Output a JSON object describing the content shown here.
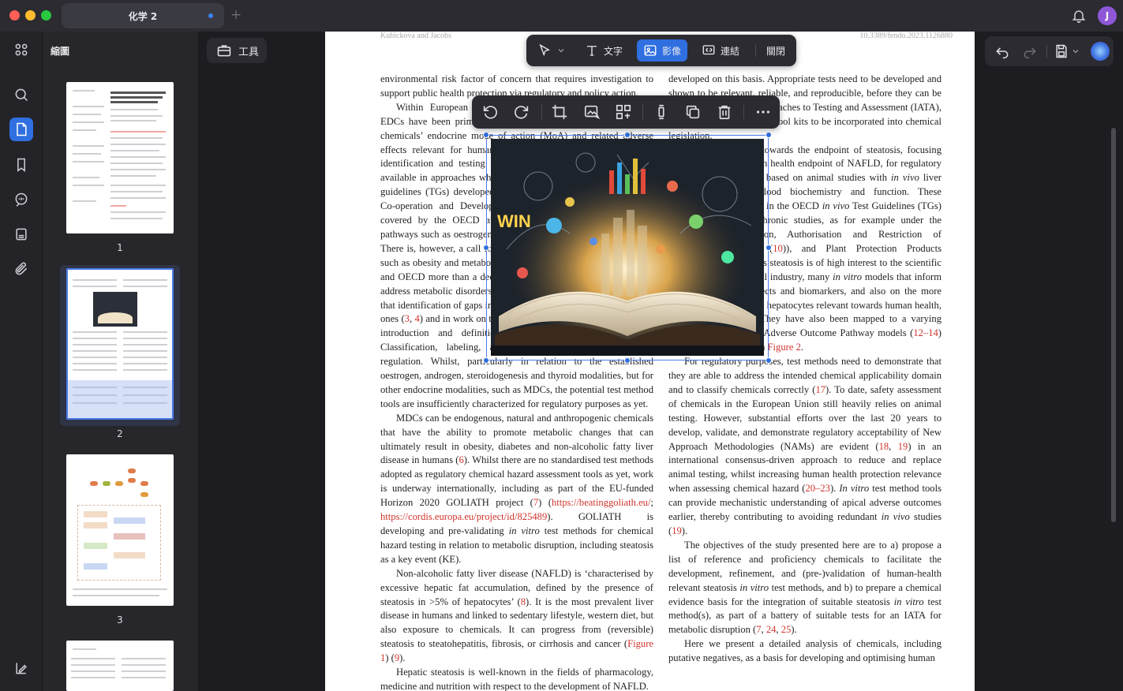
{
  "window": {
    "tab_title": "化学 2",
    "tab_add": "+",
    "avatar_letter": "J"
  },
  "sidebar": {
    "panel_title": "縮圖",
    "tools_label": "工具"
  },
  "thumbnails": [
    {
      "page": "1"
    },
    {
      "page": "2"
    },
    {
      "page": "3"
    }
  ],
  "toolbar": {
    "text_label": "文字",
    "image_label": "影像",
    "link_label": "連結",
    "close_label": "關閉"
  },
  "document": {
    "header_left": "Kubickova and Jacobs",
    "header_right": "10.3389/fendo.2023.1126880",
    "left_col": [
      {
        "indent": false,
        "html": "environmental risk factor of concern that requires investigation to support public health protection via regulatory and policy action."
      },
      {
        "indent": true,
        "html": "Within European Union (EU) and international guidelines, EDCs have been primarily identified and classified based on the chemicals’ endocrine mode of action (MoA) and related adverse effects relevant for human health. At present, methods for the identification and testing of EDCs according to their MoA are available in approaches which mainly incorporate standardised test guidelines (TGs) developed under the Organisation for Economic Co-operation and Development (OECD). Current test methods covered by the OECD are based upon well-studied endocrine pathways such as oestrogen, androgen, steroidogenesis and thyroid. There is, however, a call for additional endocrine-related endpoints such as obesity and metabolic disruption, was recognized in the EU and OECD more than a decade ago (<span class=\"ref\">2</span>). The need for methods that address metabolic disorders has been pointed out in various reports that identification of gaps in available methods and the need for new ones (<span class=\"ref\">3</span>, <span class=\"ref\">4</span>) and in work on test guideline programmes, as well as the introduction and definition of new hazard classes in the Classification, labeling, and packaging of chemicals (CLP) regulation. Whilst, particularly in relation to the established oestrogen, androgen, steroidogenesis and thyroid modalities, but for other endocrine modalities, such as MDCs, the potential test method tools are insufficiently characterized for regulatory purposes as yet."
      },
      {
        "indent": true,
        "html": "MDCs can be endogenous, natural and anthropogenic chemicals that have the ability to promote metabolic changes that can ultimately result in obesity, diabetes and non-alcoholic fatty liver disease in humans (<span class=\"ref\">6</span>). Whilst there are no standardised test methods adopted as regulatory chemical hazard assessment tools as yet, work is underway internationally, including as part of the EU-funded Horizon 2020 GOLIATH project (<span class=\"ref\">7</span>) (<span class=\"ref\">https://beatinggoliath.eu/</span>; <span class=\"ref\">https://cordis.europa.eu/project/id/825489</span>). GOLIATH is developing and pre-validating <i>in vitro</i> test methods for chemical hazard testing in relation to metabolic disruption, including steatosis as a key event (KE)."
      },
      {
        "indent": true,
        "html": "Non-alcoholic fatty liver disease (NAFLD) is ‘characterised by excessive hepatic fat accumulation, defined by the presence of steatosis in >5% of hepatocytes’ (<span class=\"ref\">8</span>). It is the most prevalent liver disease in humans and linked to sedentary lifestyle, western diet, but also exposure to chemicals. It can progress from (reversible) steatosis to steatohepatitis, fibrosis, or cirrhosis and cancer (<span class=\"ref\">Figure 1</span>) (<span class=\"ref\">9</span>)."
      },
      {
        "indent": true,
        "html": "Hepatic steatosis is well-known in the fields of pharmacology, medicine and nutrition with respect to the development of NAFLD."
      }
    ],
    "right_col": [
      {
        "indent": false,
        "html": "developed on this basis. Appropriate tests need to be developed and shown to be relevant, reliable, and reproducible, before they can be utilised in Integrated Approaches to Testing and Assessment (IATA), and ultimately be suitable tool kits to be incorporated into chemical legislation."
      },
      {
        "indent": true,
        "html": "Chemical hazards towards the endpoint of steatosis, focusing upon the adverse human health endpoint of NAFLD, for regulatory purposes, are currently based on animal studies with <i>in vivo</i> liver histochemistry and blood biochemistry and function. These parameters are reported in the OECD <i>in vivo</i> Test Guidelines (TGs) for acute, subacute, chronic studies, as for example under the Registration, Evaluation, Authorisation and Restriction of Chemicals (REACH, (<span class=\"ref\">10</span>)), and Plant Protection Products Regulation. However, as steatosis is of high interest to the scientific and the pharmacological industry, many <i>in vitro</i> models that inform upon both adverse effects and biomarkers, and also on the more mechanistic research on hepatocytes relevant towards human health, are being developed. They have also been mapped to a varying extent in (preliminary) Adverse Outcome Pathway models (<span class=\"ref\">12–14</span>) and are also indicated in <span class=\"ref\">Figure 2</span>."
      },
      {
        "indent": true,
        "html": "For regulatory purposes, test methods need to demonstrate that they are able to address the intended chemical applicability domain and to classify chemicals correctly (<span class=\"ref\">17</span>). To date, safety assessment of chemicals in the European Union still heavily relies on animal testing. However, substantial efforts over the last 20 years to develop, validate, and demonstrate regulatory acceptability of New Approach Methodologies (NAMs) are evident (<span class=\"ref\">18</span>, <span class=\"ref\">19</span>) in an international consensus-driven approach to reduce and replace animal testing, whilst increasing human health protection relevance when assessing chemical hazard (<span class=\"ref\">20–23</span>). <i>In vitro</i> test method tools can provide mechanistic understanding of apical adverse outcomes earlier, thereby contributing to avoiding redundant <i>in vivo</i> studies (<span class=\"ref\">19</span>)."
      },
      {
        "indent": true,
        "html": "The objectives of the study presented here are to a) propose a list of reference and proficiency chemicals to facilitate the development, refinement, and (pre-)validation of human-health relevant steatosis <i>in vitro</i> test methods, and b) to prepare a chemical evidence basis for the integration of suitable steatosis <i>in vitro</i> test method(s), as part of a battery of suitable tests for an IATA for metabolic disruption (<span class=\"ref\">7</span>, <span class=\"ref\">24</span>, <span class=\"ref\">25</span>)."
      },
      {
        "indent": true,
        "html": "Here we present a detailed analysis of chemicals, including putative negatives, as a basis for developing and optimising human"
      }
    ]
  }
}
